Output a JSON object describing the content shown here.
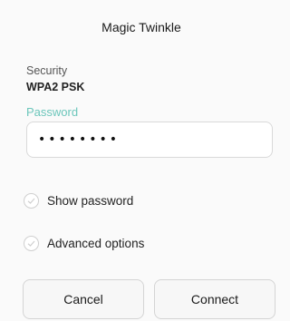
{
  "dialog": {
    "title": "Magic Twinkle",
    "security_label": "Security",
    "security_value": "WPA2 PSK",
    "password_label": "Password",
    "password_masked": "••••••••",
    "options": [
      {
        "label": "Show password",
        "checked": false,
        "icon": "checkmark-circle-icon"
      },
      {
        "label": "Advanced options",
        "checked": false,
        "icon": "checkmark-circle-icon"
      }
    ],
    "buttons": {
      "cancel": "Cancel",
      "connect": "Connect"
    }
  },
  "colors": {
    "accent": "#6cc6bb",
    "background": "#fafafa",
    "field_border": "#d9d9d9"
  }
}
